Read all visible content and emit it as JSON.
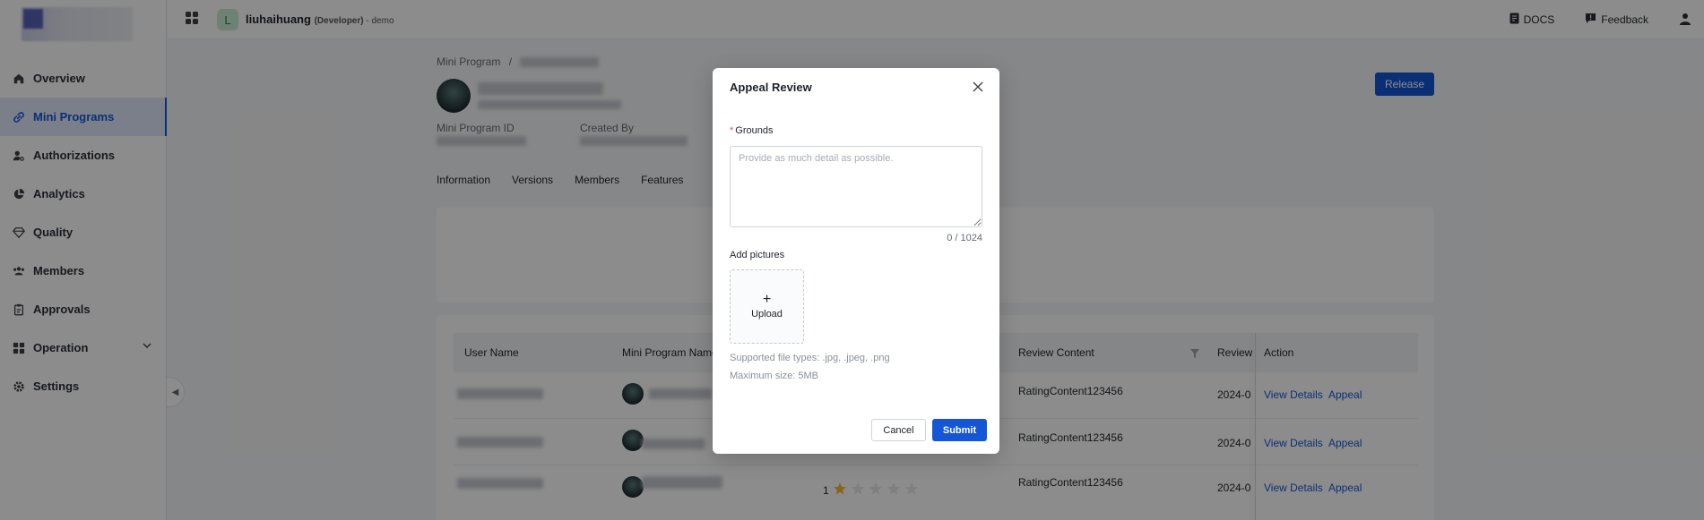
{
  "sidebar": {
    "items": [
      {
        "label": "Overview",
        "icon": "home-icon"
      },
      {
        "label": "Mini Programs",
        "icon": "link-icon",
        "active": true
      },
      {
        "label": "Authorizations",
        "icon": "user-key-icon"
      },
      {
        "label": "Analytics",
        "icon": "pie-chart-icon"
      },
      {
        "label": "Quality",
        "icon": "diamond-icon"
      },
      {
        "label": "Members",
        "icon": "team-icon"
      },
      {
        "label": "Approvals",
        "icon": "clipboard-icon"
      },
      {
        "label": "Operation",
        "icon": "grid-icon"
      },
      {
        "label": "Settings",
        "icon": "gear-icon"
      }
    ]
  },
  "topbar": {
    "avatar_letter": "L",
    "username": "liuhaihuang",
    "role": "(Developer)",
    "separator": " - ",
    "org": "demo",
    "docs_label": "DOCS",
    "feedback_label": "Feedback"
  },
  "main": {
    "breadcrumb_root": "Mini Program",
    "breadcrumb_sep": "/",
    "release_label": "Release",
    "mini_program_id_label": "Mini Program ID",
    "created_by_label": "Created By",
    "tabs": [
      "Information",
      "Versions",
      "Members",
      "Features"
    ],
    "table": {
      "headers": [
        "User Name",
        "Mini Program Name",
        "Review Content",
        "Review",
        "Action"
      ],
      "rows": [
        {
          "content": "RatingContent123456",
          "date": "2024-0",
          "rating": null
        },
        {
          "content": "RatingContent123456",
          "date": "2024-0",
          "rating": null
        },
        {
          "content": "RatingContent123456",
          "date": "2024-0",
          "rating": "1"
        }
      ],
      "view_details": "View Details",
      "appeal": "Appeal"
    }
  },
  "modal": {
    "title": "Appeal Review",
    "grounds_label": "Grounds",
    "required_mark": "*",
    "grounds_placeholder": "Provide as much detail as possible.",
    "counter": "0 / 1024",
    "add_pictures_label": "Add pictures",
    "upload_plus": "+",
    "upload_label": "Upload",
    "file_types_hint": "Supported file types: .jpg, .jpeg, .png",
    "max_size_hint": "Maximum size: 5MB",
    "cancel_label": "Cancel",
    "submit_label": "Submit"
  },
  "colors": {
    "accent": "#1456d6",
    "required": "#e34d59",
    "star": "#f5b82e"
  }
}
